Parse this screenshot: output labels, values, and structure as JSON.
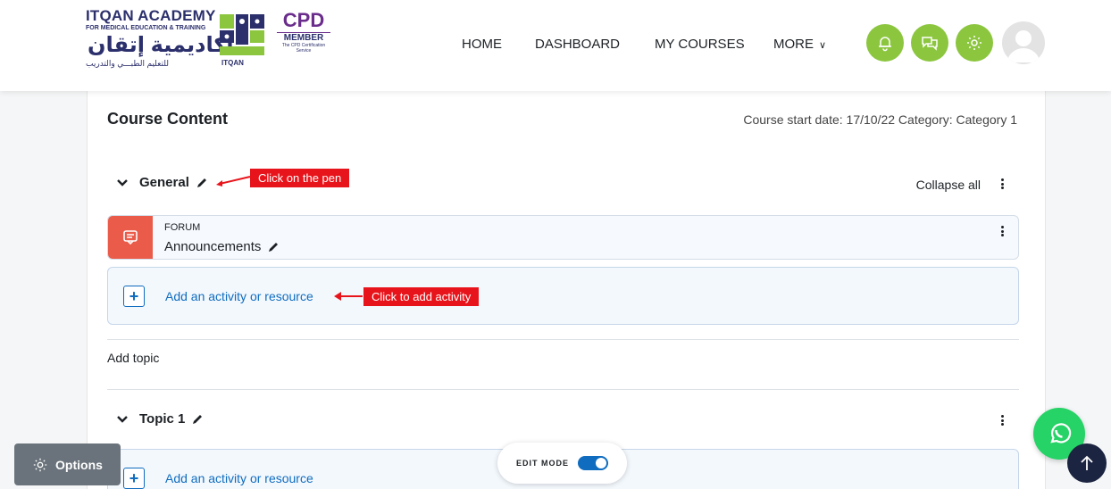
{
  "header": {
    "logo": {
      "brand_en": "ITQAN ACADEMY",
      "brand_sub": "FOR MEDICAL EDUCATION & TRAINING",
      "brand_ar": "أكاديمية إتقان",
      "brand_ar_sub": "للتعليم الطبـــي والتدريب",
      "mark_caption": "ITQAN",
      "cpd_word": "CPD",
      "cpd_member": "MEMBER",
      "cpd_service": "The CPD Certification Service"
    },
    "nav": {
      "home": "HOME",
      "dashboard": "DASHBOARD",
      "my_courses": "MY COURSES",
      "more": "MORE",
      "more_chevron": "∨"
    },
    "icons": {
      "accent": "#8cc63f",
      "notifications": "bell-icon",
      "messages": "chat-icon",
      "settings": "gear-icon"
    }
  },
  "course": {
    "title": "Course Content",
    "meta": "Course start date: 17/10/22  Category: Category 1",
    "collapse_all": "Collapse all"
  },
  "sections": {
    "general": {
      "title": "General",
      "annotation": "Click on the pen",
      "activity_type": "FORUM",
      "activity_name": "Announcements",
      "add_label": "Add an activity or resource",
      "add_annotation": "Click to add activity"
    },
    "add_topic": "Add topic",
    "topic1": {
      "title": "Topic 1",
      "add_label": "Add an activity or resource"
    }
  },
  "footer": {
    "options": "Options",
    "edit_mode": "EDIT MODE",
    "edit_mode_on": true
  },
  "colors": {
    "annotation_red": "#e8141b",
    "link_blue": "#0f6cbf",
    "forum_icon_bg": "#ea5b4a",
    "whatsapp": "#25d366"
  }
}
